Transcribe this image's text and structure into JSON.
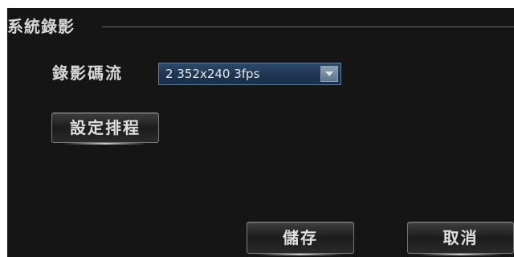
{
  "section": {
    "title": "系統錄影"
  },
  "record_stream": {
    "label": "錄影碼流",
    "selected_value": "2 352x240 3fps"
  },
  "buttons": {
    "schedule_label": "設定排程",
    "save_label": "儲存",
    "cancel_label": "取消"
  },
  "colors": {
    "panel_background": "#151515",
    "select_background": "#1e3552",
    "text": "#d8d8d8"
  }
}
